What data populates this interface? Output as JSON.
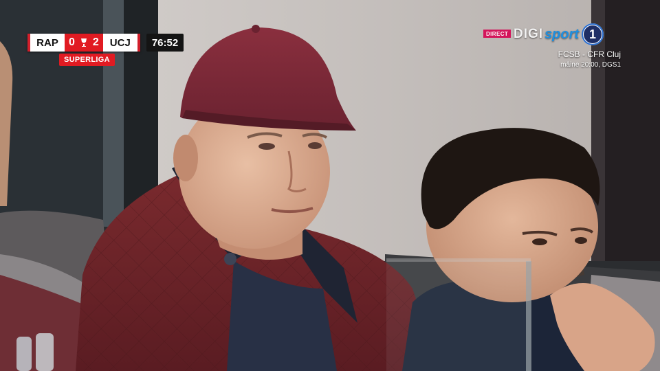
{
  "scoreboard": {
    "home_team": "RAP",
    "home_score": "0",
    "away_score": "2",
    "away_team": "UCJ",
    "match_clock": "76:52",
    "league_badge": "SUPERLIGA",
    "accent_color": "#e11b22"
  },
  "broadcaster": {
    "live_label": "DIRECT",
    "brand_part1": "DIGI",
    "brand_part2": "sport",
    "channel_number": "1",
    "brand_color": "#1e8fe0"
  },
  "promo": {
    "next_match": "FCSB - CFR Cluj",
    "schedule": "mâine 20:00, DGS1"
  }
}
